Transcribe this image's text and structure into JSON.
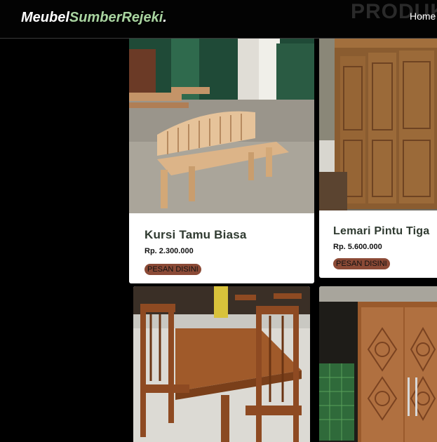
{
  "header": {
    "logo_primary": "Meubel",
    "logo_accent": "SumberRejeki",
    "logo_suffix": ".",
    "section_heading": "PRODUK",
    "nav_home": "Home"
  },
  "colors": {
    "background": "#000000",
    "logo_accent": "#a9d4a0",
    "button": "#8b4a36",
    "card": "#ffffff"
  },
  "products": [
    {
      "name": "Kursi Tamu Biasa",
      "price": "Rp. 2.300.000",
      "button_label": "PESAN DISINI",
      "image": "wooden-bench-photo"
    },
    {
      "name": "Lemari Pintu Tiga",
      "price": "Rp. 5.600.000",
      "button_label": "PESAN DISINI",
      "image": "wardrobe-photo"
    },
    {
      "image": "dining-set-photo"
    },
    {
      "image": "carved-door-photo"
    }
  ]
}
